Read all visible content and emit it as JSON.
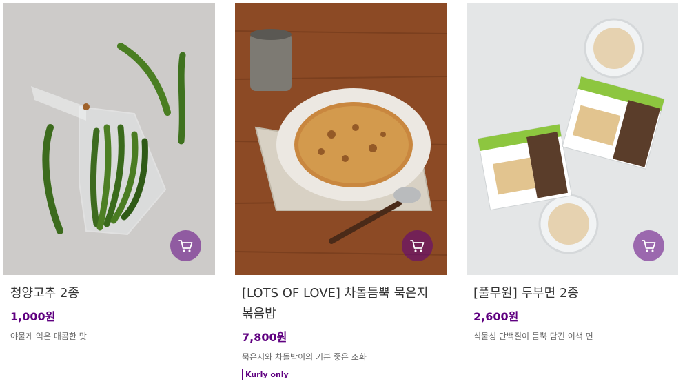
{
  "products": [
    {
      "name": "청양고추 2종",
      "price": "1,000원",
      "description": "야물게 익은 매콤한 맛",
      "badge": ""
    },
    {
      "name": "[LOTS OF LOVE] 차돌듬뿍 묵은지 볶음밥",
      "price": "7,800원",
      "description": "묵은지와 차돌박이의 기분 좋은 조화",
      "badge": "Kurly only"
    },
    {
      "name": "[풀무원] 두부면 2종",
      "price": "2,600원",
      "description": "식물성 단백질이 듬뿍 담긴 이색 면",
      "badge": ""
    }
  ],
  "colors": {
    "accent": "#5f0080",
    "cart_button": "#8a5a93"
  },
  "icons": {
    "cart": "cart-icon"
  }
}
